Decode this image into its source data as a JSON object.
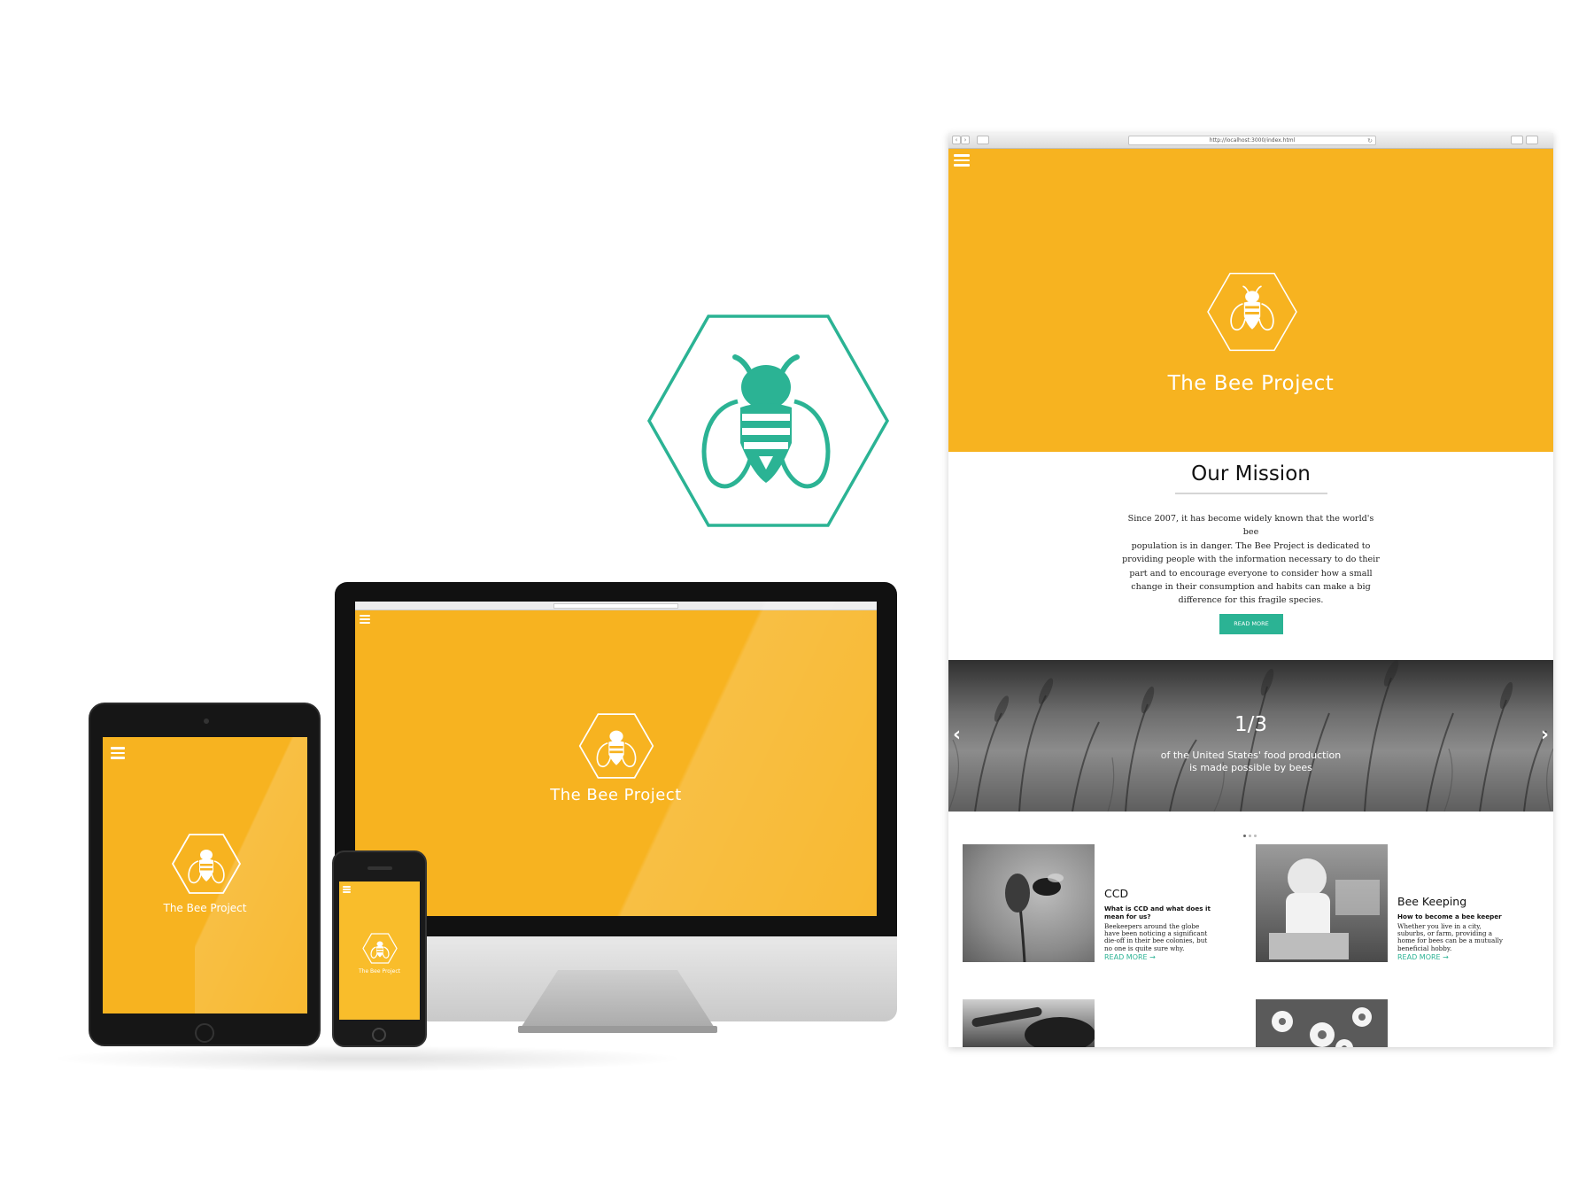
{
  "brand": {
    "name": "The Bee Project",
    "primary_color": "#f7b320",
    "accent_color": "#2bb394"
  },
  "browser": {
    "url": "http://localhost:3000/index.html"
  },
  "mission": {
    "title": "Our Mission",
    "text_lines": [
      "Since 2007, it has become widely known that the world's bee",
      "population is in danger. The Bee Project is dedicated to",
      "providing people with the information necessary to do their",
      "part and to encourage everyone to consider how a small",
      "change in their consumption and habits can make a big",
      "difference for this fragile species."
    ],
    "button_label": "READ MORE"
  },
  "slider": {
    "stat": "1/3",
    "line1": "of the United States' food production",
    "line2": "is made possible by bees",
    "prev": "‹",
    "next": "›",
    "dots_total": 3,
    "dots_active": 1
  },
  "cards": [
    {
      "title": "CCD",
      "subtitle_lines": [
        "What is CCD and what does it",
        "mean for us?"
      ],
      "body_lines": [
        "Beekeepers around the globe",
        "have been noticing a significant",
        "die-off in their bee colonies, but",
        "no one is quite sure why."
      ],
      "link": "READ MORE →"
    },
    {
      "title": "Bee Keeping",
      "subtitle_lines": [
        "How to become a bee keeper"
      ],
      "body_lines": [
        "Whether you live in a city,",
        "suburbs, or farm, providing a",
        "home for bees can be a mutually",
        "beneficial hobby."
      ],
      "link": "READ MORE →"
    }
  ],
  "icons": [
    "hamburger-menu-icon",
    "bee-hexagon-logo",
    "chevron-left-icon",
    "chevron-right-icon"
  ]
}
